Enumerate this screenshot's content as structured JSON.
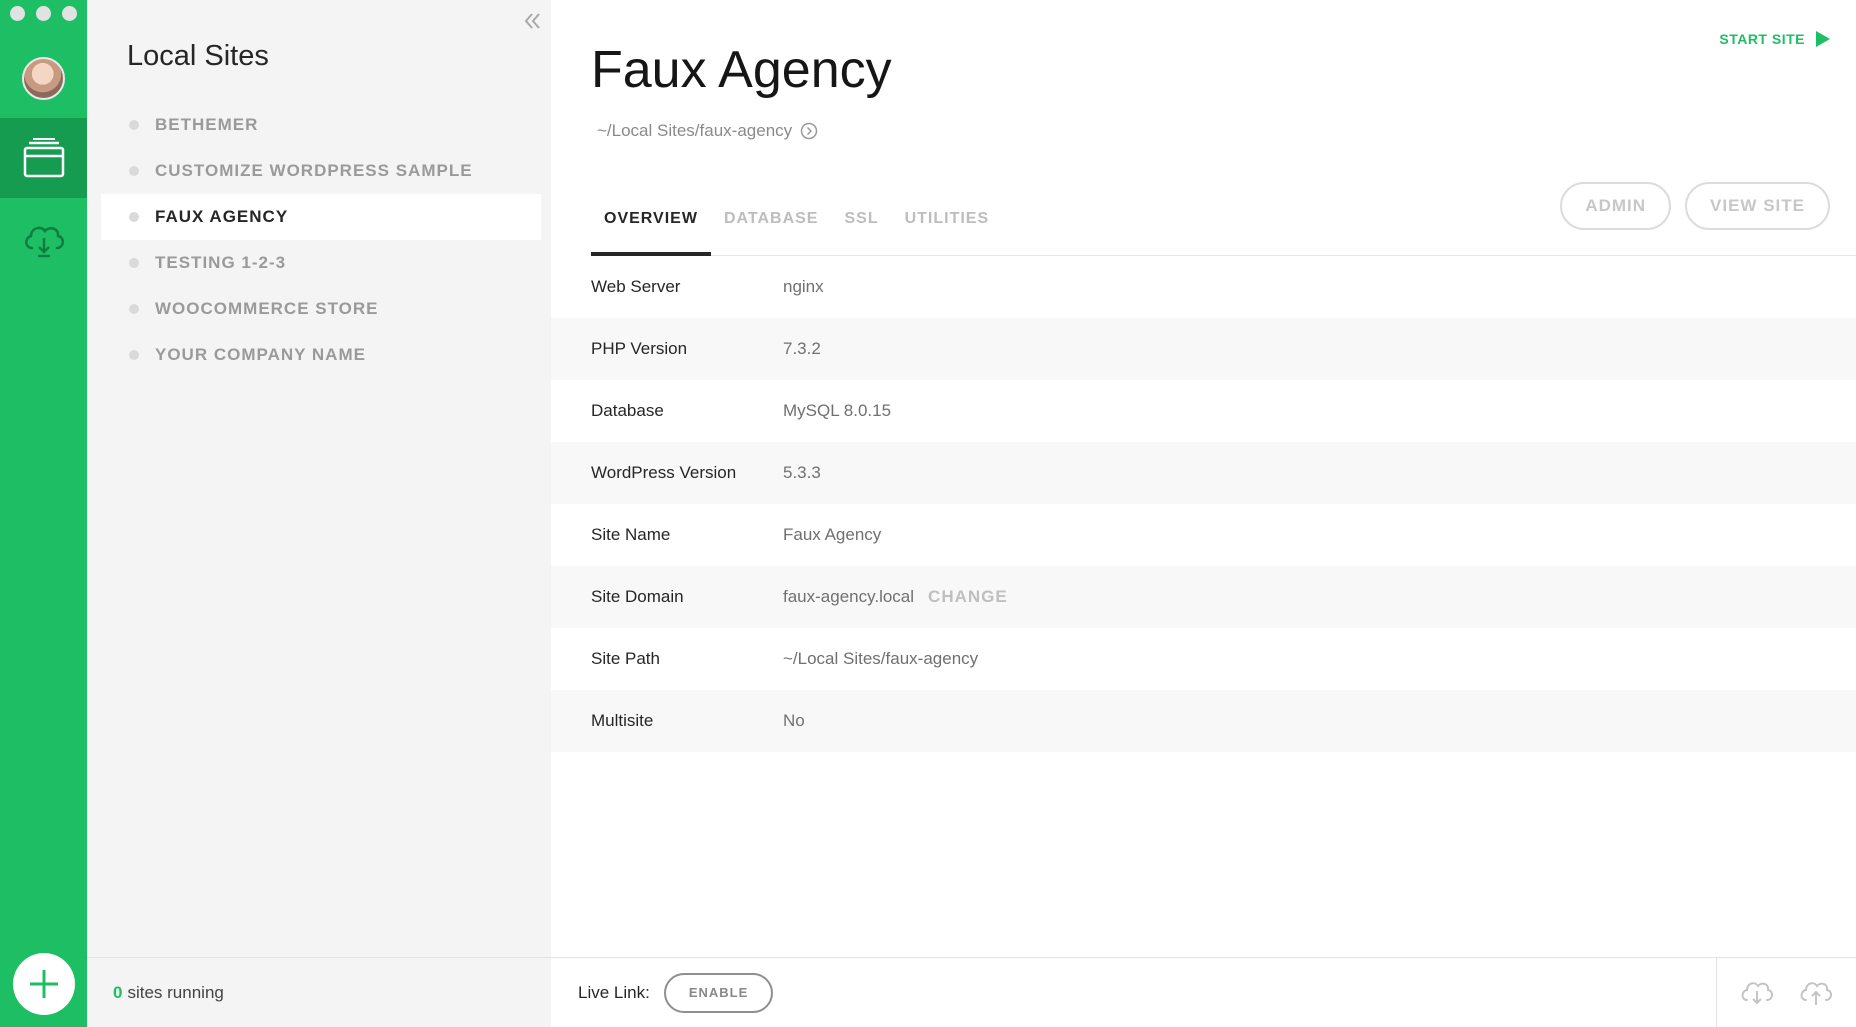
{
  "sidebar": {
    "title": "Local Sites",
    "sites": [
      {
        "label": "BETHEMER"
      },
      {
        "label": "CUSTOMIZE WORDPRESS SAMPLE"
      },
      {
        "label": "FAUX AGENCY",
        "selected": true
      },
      {
        "label": "TESTING 1-2-3"
      },
      {
        "label": "WOOCOMMERCE STORE"
      },
      {
        "label": "YOUR COMPANY NAME"
      }
    ],
    "footer": {
      "running_count": "0",
      "running_text": "sites running"
    }
  },
  "rail": {
    "icons": [
      "avatar",
      "sites-icon",
      "cloud-icon",
      "add-icon"
    ],
    "accent": "#1ebf64"
  },
  "header": {
    "start_label": "START SITE",
    "site_name": "Faux Agency",
    "site_path": "~/Local Sites/faux-agency",
    "admin_label": "ADMIN",
    "view_site_label": "VIEW SITE"
  },
  "tabs": [
    {
      "label": "OVERVIEW",
      "active": true
    },
    {
      "label": "DATABASE"
    },
    {
      "label": "SSL"
    },
    {
      "label": "UTILITIES"
    }
  ],
  "overview": [
    {
      "key": "Web Server",
      "value": "nginx"
    },
    {
      "key": "PHP Version",
      "value": "7.3.2"
    },
    {
      "key": "Database",
      "value": "MySQL 8.0.15"
    },
    {
      "key": "WordPress Version",
      "value": "5.3.3"
    },
    {
      "key": "Site Name",
      "value": "Faux Agency"
    },
    {
      "key": "Site Domain",
      "value": "faux-agency.local",
      "action": "CHANGE"
    },
    {
      "key": "Site Path",
      "value": "~/Local Sites/faux-agency"
    },
    {
      "key": "Multisite",
      "value": "No"
    }
  ],
  "footer": {
    "live_link_label": "Live Link:",
    "enable_label": "ENABLE"
  }
}
